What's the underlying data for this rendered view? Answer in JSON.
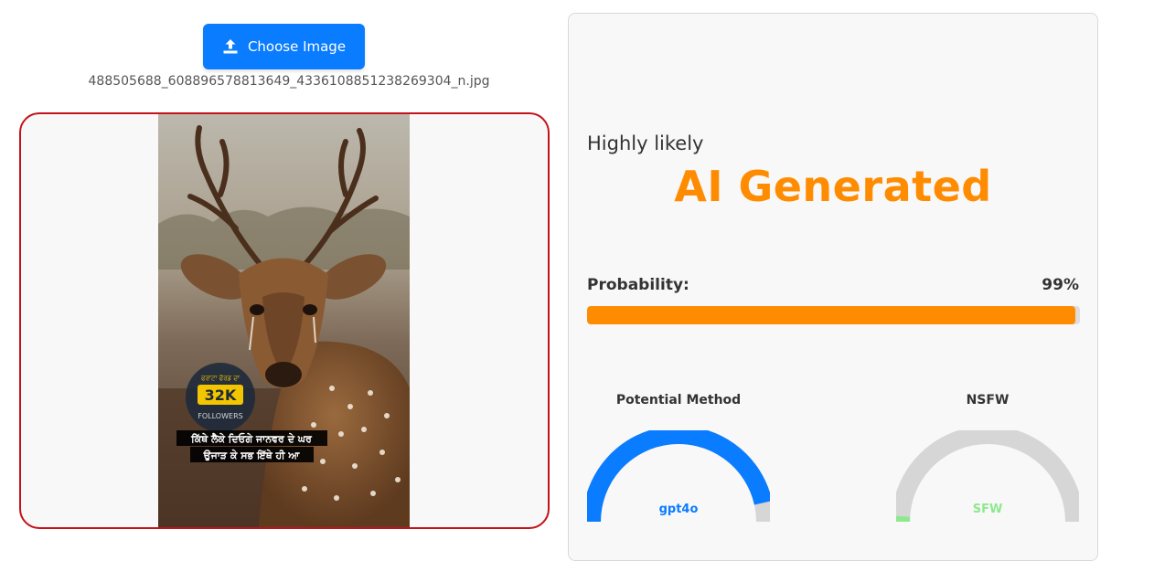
{
  "upload": {
    "button_label": "Choose Image",
    "filename": "488505688_608896578813649_4336108851238269304_n.jpg"
  },
  "image_overlay": {
    "badge_top": "ਫਰਾਟਾ ਫੋਰਡ ਦਾ",
    "badge_count": "32K",
    "badge_bottom": "FOLLOWERS",
    "caption_line1": "ਕਿੱਥੇ ਲੈਕੇ ਦਿਓਗੇ ਜਾਨਵਰ ਦੇ ਘਰ",
    "caption_line2": "ਉਜਾੜ ਕੇ ਸਭ ਇੱਥੇ ਹੀ ਆ"
  },
  "result": {
    "likelihood": "Highly likely",
    "verdict": "AI Generated",
    "probability_label": "Probability:",
    "probability_text": "99%",
    "probability_value": 0.99
  },
  "gauges": {
    "method": {
      "title": "Potential Method",
      "label": "gpt4o",
      "value": 0.93,
      "color": "#0a7cff",
      "label_color": "#0a7cff"
    },
    "nsfw": {
      "title": "NSFW",
      "label": "SFW",
      "value": 0.02,
      "color": "#8ee88e",
      "label_color": "#8ee88e"
    }
  },
  "colors": {
    "accent": "#0a7cff",
    "verdict": "#ff8c00",
    "frame_border": "#c4121b"
  }
}
